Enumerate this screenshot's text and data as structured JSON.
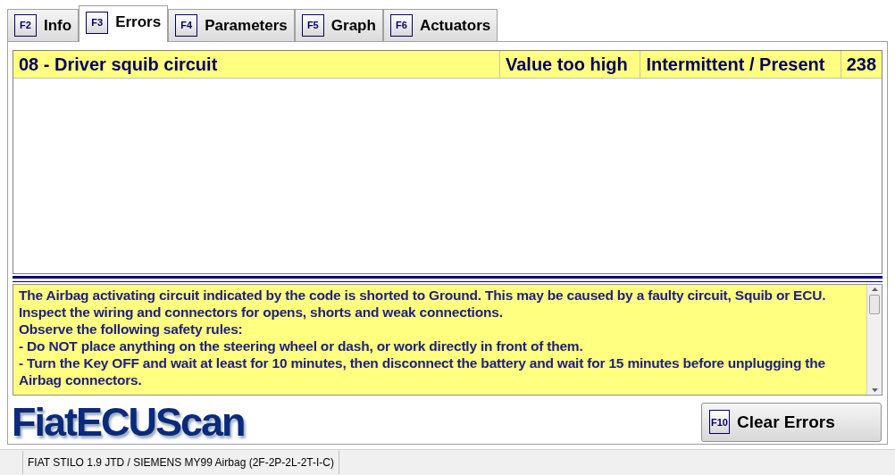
{
  "tabs": [
    {
      "key": "F2",
      "label": "Info",
      "selected": false
    },
    {
      "key": "F3",
      "label": "Errors",
      "selected": true
    },
    {
      "key": "F4",
      "label": "Parameters",
      "selected": false
    },
    {
      "key": "F5",
      "label": "Graph",
      "selected": false
    },
    {
      "key": "F6",
      "label": "Actuators",
      "selected": false
    }
  ],
  "errors": [
    {
      "description": "08 - Driver squib circuit",
      "type": "Value too high",
      "status": "Intermittent / Present",
      "count": "238",
      "selected": true
    }
  ],
  "details": [
    "The Airbag activating circuit indicated by the code is shorted to Ground. This may be caused by a faulty circuit, Squib or ECU.",
    "Inspect the wiring and connectors for opens, shorts and weak connections.",
    "Observe the following safety rules:",
    "- Do NOT place anything on the steering wheel or dash, or work directly in front of them.",
    "- Turn the Key OFF and wait at least for 10 minutes, then disconnect the battery and wait for 15 minutes before unplugging the Airbag connectors."
  ],
  "logo": "FiatECUScan",
  "clear_button": {
    "key": "F10",
    "label": "Clear Errors"
  },
  "status_bar": "FIAT STILO 1.9 JTD / SIEMENS MY99 Airbag (2F-2P-2L-2T-I-C)"
}
